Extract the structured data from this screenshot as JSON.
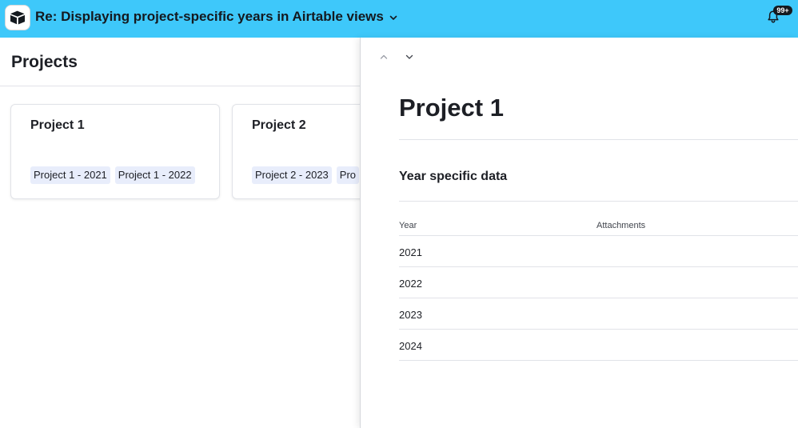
{
  "topbar": {
    "title": "Re: Displaying project-specific years in Airtable views",
    "notification_badge": "99+",
    "background_color": "#3ec8fa",
    "logo_icon": "airtable-logo-icon"
  },
  "page": {
    "title": "Projects"
  },
  "cards": [
    {
      "title": "Project 1",
      "chips": [
        "Project 1 - 2021",
        "Project 1 - 2022"
      ]
    },
    {
      "title": "Project 2",
      "chips": [
        "Project 2 - 2023",
        "Pro"
      ]
    }
  ],
  "detail": {
    "record_title": "Project 1",
    "section_title": "Year specific data",
    "columns": [
      "Year",
      "Attachments"
    ],
    "rows": [
      {
        "year": "2021",
        "attachments": ""
      },
      {
        "year": "2022",
        "attachments": ""
      },
      {
        "year": "2023",
        "attachments": ""
      },
      {
        "year": "2024",
        "attachments": ""
      }
    ]
  }
}
